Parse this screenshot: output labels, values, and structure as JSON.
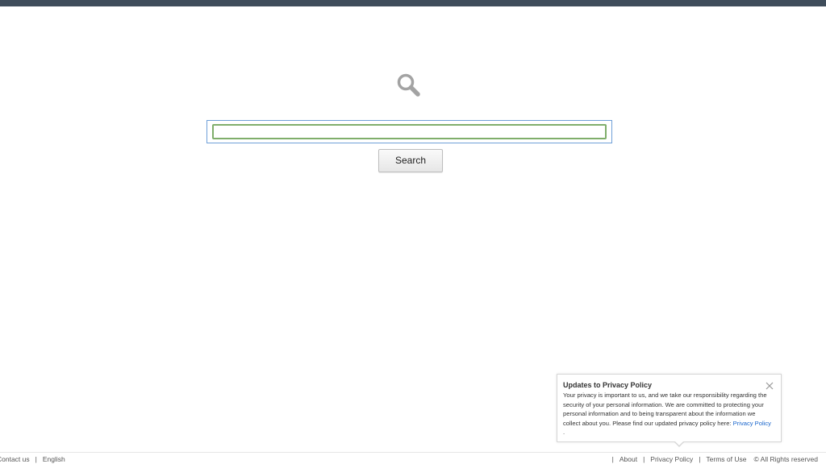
{
  "header": {
    "bar_color": "#3f4d5b"
  },
  "logo": {
    "icon": "magnifier-icon"
  },
  "search": {
    "value": "",
    "placeholder": "",
    "button_label": "Search",
    "focus_color": "#7fae6b"
  },
  "privacy_popup": {
    "title": "Updates to Privacy Policy",
    "body": "Your privacy is important to us, and we take our responsibility regarding the security of your personal information. We are committed to protecting your personal information and to being transparent about the information we collect about you. Please find our updated privacy policy here:",
    "link_text": "Privacy Policy",
    "trailing": ".",
    "close_icon": "close-icon"
  },
  "footer": {
    "left": {
      "contact": "Contact us",
      "separator": "|",
      "language": "English"
    },
    "right": {
      "separator": "|",
      "about": "About",
      "privacy": "Privacy Policy",
      "terms": "Terms of Use",
      "copyright": "© All Rights reserved"
    }
  },
  "colors": {
    "link": "#1a66cc",
    "input_frame": "#6f9fd8"
  }
}
